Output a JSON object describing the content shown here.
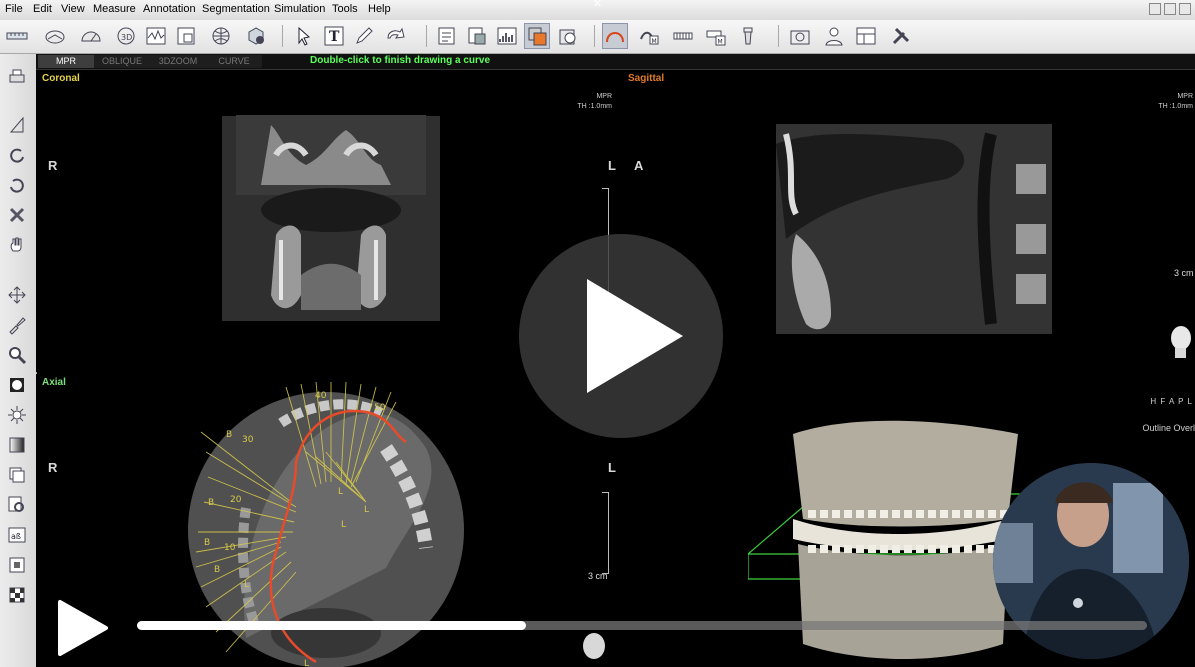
{
  "menu": [
    "File",
    "Edit",
    "View",
    "Measure",
    "Annotation",
    "Segmentation",
    "Simulation",
    "Tools",
    "Help"
  ],
  "close_glyph": "×",
  "toolbar": {
    "icons": [
      "ruler-icon",
      "angle-icon",
      "protractor-icon",
      "volume-3d-icon",
      "profile-icon",
      "roi-icon",
      "globe-icon",
      "cube-icon",
      "pointer-icon",
      "text-icon",
      "pencil-icon",
      "arrow-icon",
      "report-icon",
      "capture-icon",
      "histogram-icon",
      "overlay-icon",
      "reset-view-icon",
      "curve-icon",
      "nerve-marking-icon",
      "panoramic-icon",
      "implant-library-icon",
      "crown-icon",
      "snapshot-icon",
      "patient-icon",
      "layout-icon",
      "tools-icon"
    ],
    "text_tool_glyph": "T"
  },
  "left_tools": [
    "print-icon",
    "triangle-icon",
    "rotate-ccw-icon",
    "rotate-cw-icon",
    "delete-icon",
    "pan-icon",
    "move-icon",
    "brush-icon",
    "zoom-icon",
    "contrast-icon",
    "brightness-icon",
    "gradient-icon",
    "layers-icon",
    "find-icon",
    "invert-icon",
    "reset-icon",
    "checker-icon"
  ],
  "view_tabs": [
    "MPR",
    "OBLIQUE",
    "3DZOOM",
    "CURVE"
  ],
  "active_tab": "MPR",
  "status_message": "Double-click to finish drawing a curve",
  "panes": {
    "coronal": {
      "title": "Coronal",
      "left": "R",
      "right": "L",
      "info1": "MPR",
      "info2": "TH :1.0mm"
    },
    "sagittal": {
      "title": "Sagittal",
      "left": "A",
      "info1": "MPR",
      "info2": "TH :1.0mm",
      "scale": "3 cm"
    },
    "axial": {
      "title": "Axial",
      "left": "R",
      "right": "L",
      "scale": "3 cm",
      "arch_labels": [
        "40",
        "50",
        "30",
        "20",
        "10",
        "B",
        "B",
        "B",
        "B",
        "L",
        "L",
        "L",
        "L",
        "L"
      ]
    },
    "volume": {
      "orient": "H F A P L",
      "overlay": "Outline Overl"
    }
  },
  "colors": {
    "coronal_title": "#e6d34a",
    "sagittal_title": "#e07a2a",
    "axial_title": "#7de07d",
    "curve": "#e84a2a",
    "guides": "#d6c94a",
    "box": "#3cd23c"
  },
  "video": {
    "progress": 0.385
  }
}
